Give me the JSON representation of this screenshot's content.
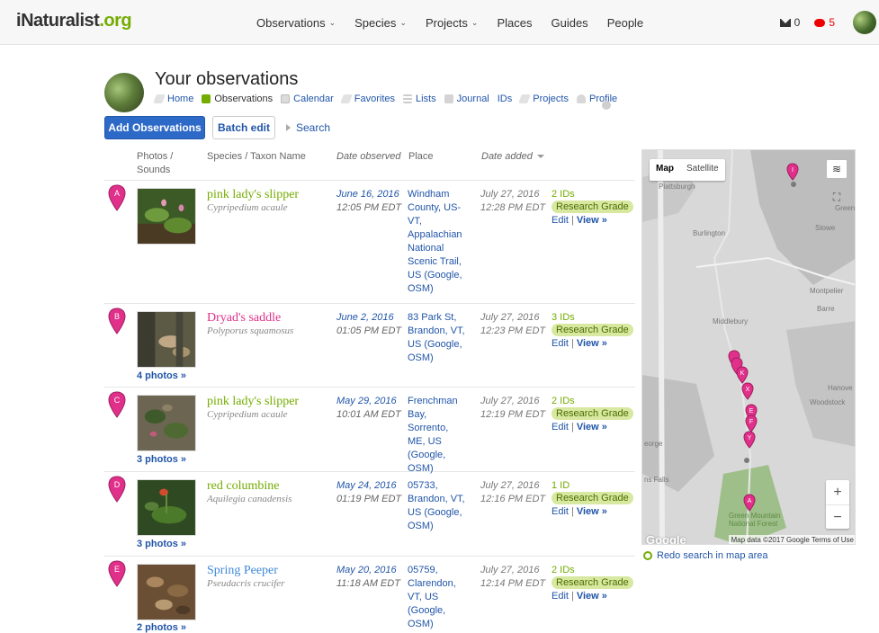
{
  "site": {
    "logo_i": "i",
    "logo_nat": "Naturalist",
    "logo_org": ".org"
  },
  "nav": {
    "observations": "Observations",
    "species": "Species",
    "projects": "Projects",
    "places": "Places",
    "guides": "Guides",
    "people": "People",
    "chevron": "⌄",
    "messages_count": "0",
    "notifications_count": "5"
  },
  "header": {
    "title": "Your observations",
    "subnav": [
      "Home",
      "Observations",
      "Calendar",
      "Favorites",
      "Lists",
      "Journal",
      "IDs",
      "Projects",
      "Profile"
    ]
  },
  "actions": {
    "add_label": "Add Observations",
    "batch_label": "Batch edit",
    "search_label": "Search"
  },
  "table": {
    "headers": {
      "photos": "Photos /",
      "sounds": "Sounds",
      "species": "Species / Taxon Name",
      "date_observed": "Date observed",
      "place": "Place",
      "date_added": "Date added"
    },
    "rows": [
      {
        "marker": "A",
        "common_name": "pink lady's slipper",
        "scientific_name": "Cypripedium acaule",
        "date_observed": "June 16, 2016",
        "time_observed": "12:05 PM EDT",
        "place": "Windham County, US-VT, Appalachian National Scenic Trail, US (Google, OSM)",
        "date_added": "July 27, 2016",
        "time_added": "12:28 PM EDT",
        "ids": "2 IDs",
        "badge": "Research Grade",
        "edit": "Edit",
        "view": "View »",
        "photos_link": ""
      },
      {
        "marker": "B",
        "common_name": "Dryad's saddle",
        "scientific_name": "Polyporus squamosus",
        "date_observed": "June 2, 2016",
        "time_observed": "01:05 PM EDT",
        "place": "83 Park St, Brandon, VT, US (Google, OSM)",
        "date_added": "July 27, 2016",
        "time_added": "12:23 PM EDT",
        "ids": "3 IDs",
        "badge": "Research Grade",
        "edit": "Edit",
        "view": "View »",
        "photos_link": "4 photos »"
      },
      {
        "marker": "C",
        "common_name": "pink lady's slipper",
        "scientific_name": "Cypripedium acaule",
        "date_observed": "May 29, 2016",
        "time_observed": "10:01 AM EDT",
        "place": "Frenchman Bay, Sorrento, ME, US (Google, OSM)",
        "date_added": "July 27, 2016",
        "time_added": "12:19 PM EDT",
        "ids": "2 IDs",
        "badge": "Research Grade",
        "edit": "Edit",
        "view": "View »",
        "photos_link": "3 photos »"
      },
      {
        "marker": "D",
        "common_name": "red columbine",
        "scientific_name": "Aquilegia canadensis",
        "date_observed": "May 24, 2016",
        "time_observed": "01:19 PM EDT",
        "place": "05733, Brandon, VT, US (Google, OSM)",
        "date_added": "July 27, 2016",
        "time_added": "12:16 PM EDT",
        "ids": "1 ID",
        "badge": "Research Grade",
        "edit": "Edit",
        "view": "View »",
        "photos_link": "3 photos »"
      },
      {
        "marker": "E",
        "common_name": "Spring Peeper",
        "scientific_name": "Pseudacris crucifer",
        "date_observed": "May 20, 2016",
        "time_observed": "11:18 AM EDT",
        "place": "05759, Clarendon, VT, US (Google, OSM)",
        "date_added": "July 27, 2016",
        "time_added": "12:14 PM EDT",
        "ids": "2 IDs",
        "badge": "Research Grade",
        "edit": "Edit",
        "view": "View »",
        "photos_link": "2 photos »"
      }
    ]
  },
  "map": {
    "map_label": "Map",
    "satellite_label": "Satellite",
    "credit": "Map data ©2017 Google  Terms of Use",
    "google": "Google",
    "zoom_in": "+",
    "zoom_out": "−",
    "labels": [
      "Plattsburgh",
      "Burlington",
      "Stowe",
      "Montpelier",
      "Barre",
      "Middlebury",
      "Woodstock",
      "Greensbo",
      "Hanove",
      "ns Falls",
      "eorge",
      "Green Mountain National Forest"
    ],
    "pin_letters": [
      "I",
      "K",
      "X",
      "E",
      "F",
      "Y",
      "A"
    ],
    "redo_label": "Redo search in map area"
  },
  "colors": {
    "accent": "#74ac00",
    "link": "#2155a8",
    "pin": "#e0308a",
    "primary_button": "#2d69c6"
  }
}
